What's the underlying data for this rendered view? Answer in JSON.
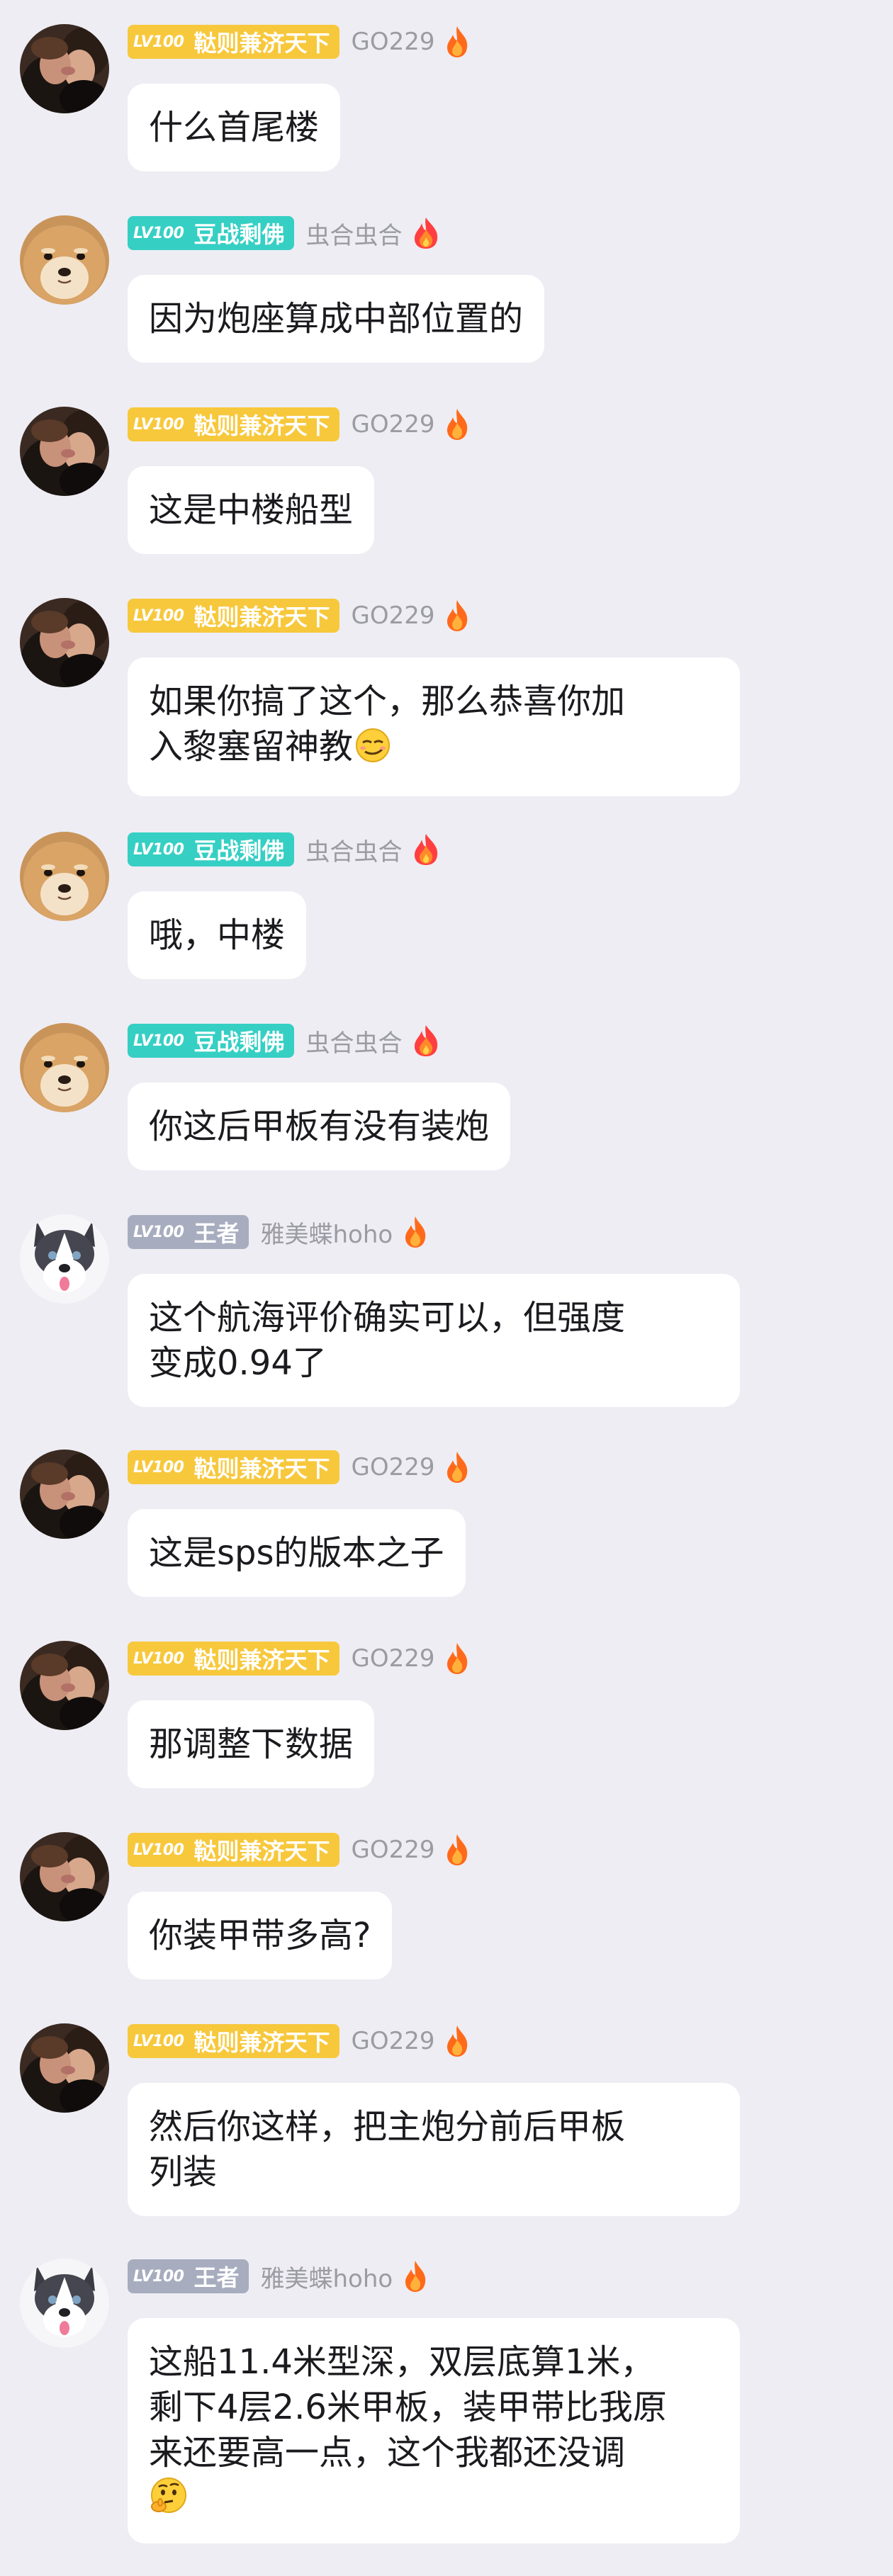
{
  "level_label": "LV100",
  "titles": {
    "gold": "鞑则兼济天下",
    "teal": "豆战剩佛",
    "gray": "王者"
  },
  "users": {
    "go229": "GO229",
    "chonghe": "虫合虫合",
    "yamei": "雅美蝶hoho"
  },
  "icons": {
    "fire_orange": "fire-icon",
    "fire_red": "fire-red-icon",
    "emoji_smirk": "smirk-emoji-icon",
    "emoji_thinking": "thinking-emoji-icon"
  },
  "messages": [
    {
      "text": [
        "什么首尾楼"
      ]
    },
    {
      "text": [
        "因为炮座算成中部位置的"
      ]
    },
    {
      "text": [
        "这是中楼船型"
      ]
    },
    {
      "text": [
        "如果你搞了这个，那么恭喜你加",
        "入黎塞留神教"
      ]
    },
    {
      "text": [
        "哦，中楼"
      ]
    },
    {
      "text": [
        "你这后甲板有没有装炮"
      ]
    },
    {
      "text": [
        "这个航海评价确实可以，但强度",
        "变成0.94了"
      ]
    },
    {
      "text": [
        "这是sps的版本之子"
      ]
    },
    {
      "text": [
        "那调整下数据"
      ]
    },
    {
      "text": [
        "你装甲带多高?"
      ]
    },
    {
      "text": [
        "然后你这样，把主炮分前后甲板",
        "列装"
      ]
    },
    {
      "text": [
        "这船11.4米型深，双层底算1米，",
        "剩下4层2.6米甲板，装甲带比我原",
        "来还要高一点，这个我都还没调"
      ]
    }
  ],
  "colors": {
    "background": "#eeedf3",
    "badge_gold": "#f7c83c",
    "badge_teal": "#36cfc4",
    "badge_gray": "#a7adbf",
    "username": "#9b9ba3"
  }
}
